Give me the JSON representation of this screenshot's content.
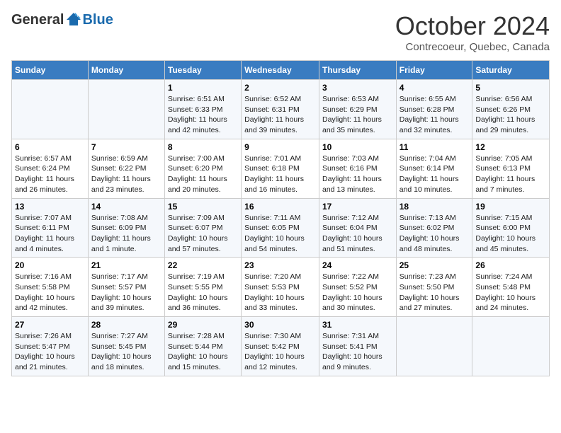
{
  "header": {
    "logo_general": "General",
    "logo_blue": "Blue",
    "month": "October 2024",
    "location": "Contrecoeur, Quebec, Canada"
  },
  "weekdays": [
    "Sunday",
    "Monday",
    "Tuesday",
    "Wednesday",
    "Thursday",
    "Friday",
    "Saturday"
  ],
  "weeks": [
    [
      {
        "day": "",
        "sunrise": "",
        "sunset": "",
        "daylight": ""
      },
      {
        "day": "",
        "sunrise": "",
        "sunset": "",
        "daylight": ""
      },
      {
        "day": "1",
        "sunrise": "Sunrise: 6:51 AM",
        "sunset": "Sunset: 6:33 PM",
        "daylight": "Daylight: 11 hours and 42 minutes."
      },
      {
        "day": "2",
        "sunrise": "Sunrise: 6:52 AM",
        "sunset": "Sunset: 6:31 PM",
        "daylight": "Daylight: 11 hours and 39 minutes."
      },
      {
        "day": "3",
        "sunrise": "Sunrise: 6:53 AM",
        "sunset": "Sunset: 6:29 PM",
        "daylight": "Daylight: 11 hours and 35 minutes."
      },
      {
        "day": "4",
        "sunrise": "Sunrise: 6:55 AM",
        "sunset": "Sunset: 6:28 PM",
        "daylight": "Daylight: 11 hours and 32 minutes."
      },
      {
        "day": "5",
        "sunrise": "Sunrise: 6:56 AM",
        "sunset": "Sunset: 6:26 PM",
        "daylight": "Daylight: 11 hours and 29 minutes."
      }
    ],
    [
      {
        "day": "6",
        "sunrise": "Sunrise: 6:57 AM",
        "sunset": "Sunset: 6:24 PM",
        "daylight": "Daylight: 11 hours and 26 minutes."
      },
      {
        "day": "7",
        "sunrise": "Sunrise: 6:59 AM",
        "sunset": "Sunset: 6:22 PM",
        "daylight": "Daylight: 11 hours and 23 minutes."
      },
      {
        "day": "8",
        "sunrise": "Sunrise: 7:00 AM",
        "sunset": "Sunset: 6:20 PM",
        "daylight": "Daylight: 11 hours and 20 minutes."
      },
      {
        "day": "9",
        "sunrise": "Sunrise: 7:01 AM",
        "sunset": "Sunset: 6:18 PM",
        "daylight": "Daylight: 11 hours and 16 minutes."
      },
      {
        "day": "10",
        "sunrise": "Sunrise: 7:03 AM",
        "sunset": "Sunset: 6:16 PM",
        "daylight": "Daylight: 11 hours and 13 minutes."
      },
      {
        "day": "11",
        "sunrise": "Sunrise: 7:04 AM",
        "sunset": "Sunset: 6:14 PM",
        "daylight": "Daylight: 11 hours and 10 minutes."
      },
      {
        "day": "12",
        "sunrise": "Sunrise: 7:05 AM",
        "sunset": "Sunset: 6:13 PM",
        "daylight": "Daylight: 11 hours and 7 minutes."
      }
    ],
    [
      {
        "day": "13",
        "sunrise": "Sunrise: 7:07 AM",
        "sunset": "Sunset: 6:11 PM",
        "daylight": "Daylight: 11 hours and 4 minutes."
      },
      {
        "day": "14",
        "sunrise": "Sunrise: 7:08 AM",
        "sunset": "Sunset: 6:09 PM",
        "daylight": "Daylight: 11 hours and 1 minute."
      },
      {
        "day": "15",
        "sunrise": "Sunrise: 7:09 AM",
        "sunset": "Sunset: 6:07 PM",
        "daylight": "Daylight: 10 hours and 57 minutes."
      },
      {
        "day": "16",
        "sunrise": "Sunrise: 7:11 AM",
        "sunset": "Sunset: 6:05 PM",
        "daylight": "Daylight: 10 hours and 54 minutes."
      },
      {
        "day": "17",
        "sunrise": "Sunrise: 7:12 AM",
        "sunset": "Sunset: 6:04 PM",
        "daylight": "Daylight: 10 hours and 51 minutes."
      },
      {
        "day": "18",
        "sunrise": "Sunrise: 7:13 AM",
        "sunset": "Sunset: 6:02 PM",
        "daylight": "Daylight: 10 hours and 48 minutes."
      },
      {
        "day": "19",
        "sunrise": "Sunrise: 7:15 AM",
        "sunset": "Sunset: 6:00 PM",
        "daylight": "Daylight: 10 hours and 45 minutes."
      }
    ],
    [
      {
        "day": "20",
        "sunrise": "Sunrise: 7:16 AM",
        "sunset": "Sunset: 5:58 PM",
        "daylight": "Daylight: 10 hours and 42 minutes."
      },
      {
        "day": "21",
        "sunrise": "Sunrise: 7:17 AM",
        "sunset": "Sunset: 5:57 PM",
        "daylight": "Daylight: 10 hours and 39 minutes."
      },
      {
        "day": "22",
        "sunrise": "Sunrise: 7:19 AM",
        "sunset": "Sunset: 5:55 PM",
        "daylight": "Daylight: 10 hours and 36 minutes."
      },
      {
        "day": "23",
        "sunrise": "Sunrise: 7:20 AM",
        "sunset": "Sunset: 5:53 PM",
        "daylight": "Daylight: 10 hours and 33 minutes."
      },
      {
        "day": "24",
        "sunrise": "Sunrise: 7:22 AM",
        "sunset": "Sunset: 5:52 PM",
        "daylight": "Daylight: 10 hours and 30 minutes."
      },
      {
        "day": "25",
        "sunrise": "Sunrise: 7:23 AM",
        "sunset": "Sunset: 5:50 PM",
        "daylight": "Daylight: 10 hours and 27 minutes."
      },
      {
        "day": "26",
        "sunrise": "Sunrise: 7:24 AM",
        "sunset": "Sunset: 5:48 PM",
        "daylight": "Daylight: 10 hours and 24 minutes."
      }
    ],
    [
      {
        "day": "27",
        "sunrise": "Sunrise: 7:26 AM",
        "sunset": "Sunset: 5:47 PM",
        "daylight": "Daylight: 10 hours and 21 minutes."
      },
      {
        "day": "28",
        "sunrise": "Sunrise: 7:27 AM",
        "sunset": "Sunset: 5:45 PM",
        "daylight": "Daylight: 10 hours and 18 minutes."
      },
      {
        "day": "29",
        "sunrise": "Sunrise: 7:28 AM",
        "sunset": "Sunset: 5:44 PM",
        "daylight": "Daylight: 10 hours and 15 minutes."
      },
      {
        "day": "30",
        "sunrise": "Sunrise: 7:30 AM",
        "sunset": "Sunset: 5:42 PM",
        "daylight": "Daylight: 10 hours and 12 minutes."
      },
      {
        "day": "31",
        "sunrise": "Sunrise: 7:31 AM",
        "sunset": "Sunset: 5:41 PM",
        "daylight": "Daylight: 10 hours and 9 minutes."
      },
      {
        "day": "",
        "sunrise": "",
        "sunset": "",
        "daylight": ""
      },
      {
        "day": "",
        "sunrise": "",
        "sunset": "",
        "daylight": ""
      }
    ]
  ]
}
